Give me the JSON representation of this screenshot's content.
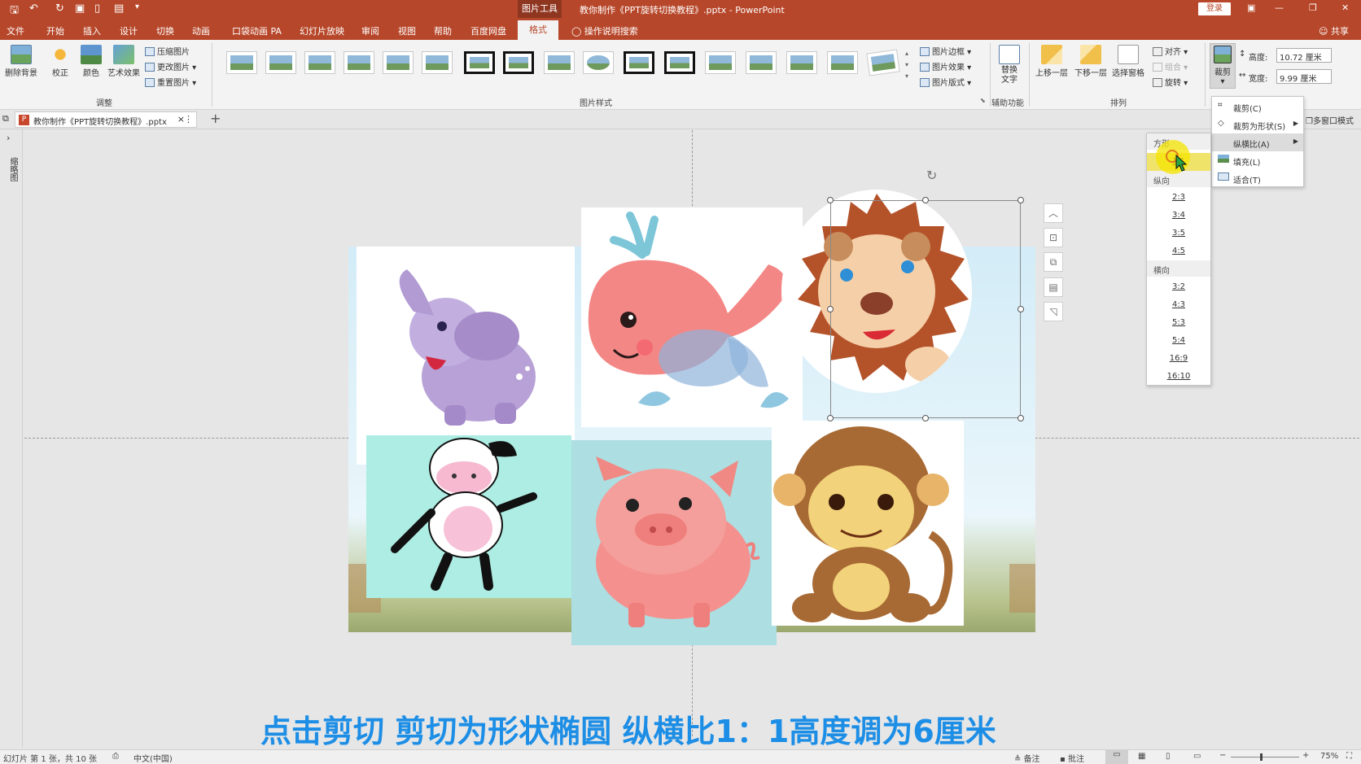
{
  "titlebar": {
    "context_tab": "图片工具",
    "title": "教你制作《PPT旋转切换教程》.pptx  -  PowerPoint",
    "login": "登录"
  },
  "tabs": [
    "文件",
    "开始",
    "插入",
    "设计",
    "切换",
    "动画",
    "口袋动画 PA",
    "幻灯片放映",
    "审阅",
    "视图",
    "帮助",
    "百度网盘"
  ],
  "active_tab": "格式",
  "tell_me": "操作说明搜索",
  "share": "共享",
  "ribbon": {
    "remove_bg": "删除背景",
    "correct": "校正",
    "color": "颜色",
    "art_effect": "艺术效果",
    "compress": "压缩图片",
    "change": "更改图片",
    "reset": "重置图片",
    "adjust_group": "调整",
    "styles_group": "图片样式",
    "border": "图片边框",
    "effect": "图片效果",
    "layout": "图片版式",
    "alt_text": "替换文字",
    "accessibility_group": "辅助功能",
    "bring_forward": "上移一层",
    "send_backward": "下移一层",
    "selection_pane": "选择窗格",
    "align": "对齐",
    "group": "组合",
    "rotate": "旋转",
    "arrange_group": "排列",
    "crop": "裁剪",
    "height_label": "高度:",
    "height_value": "10.72 厘米",
    "width_label": "宽度:",
    "width_value": "9.99 厘米"
  },
  "doc_tab": "教你制作《PPT旋转切换教程》.pptx",
  "multi_window": "多窗口模式",
  "thumb_pane_label": "缩略图",
  "crop_menu": {
    "crop": "裁剪(C)",
    "crop_to_shape": "裁剪为形状(S)",
    "aspect_ratio": "纵横比(A)",
    "fill": "填充(L)",
    "fit": "适合(T)"
  },
  "ratio_menu": {
    "square_header": "方形",
    "square": "1:1",
    "portrait_header": "纵向",
    "portrait": [
      "2:3",
      "3:4",
      "3:5",
      "4:5"
    ],
    "landscape_header": "横向",
    "landscape": [
      "3:2",
      "4:3",
      "5:3",
      "5:4",
      "16:9",
      "16:10"
    ]
  },
  "slide": {
    "animals": [
      "elephant",
      "whale",
      "lion",
      "cow",
      "pig",
      "monkey"
    ]
  },
  "caption": "点击剪切 剪切为形状椭圆 纵横比1：1高度调为6厘米",
  "statusbar": {
    "slide_info": "幻灯片 第 1 张，共 10 张",
    "language": "中文(中国)",
    "notes": "备注",
    "comments": "批注",
    "zoom": "75%"
  },
  "colors": {
    "accent": "#b7472a",
    "caption": "#1d8ee6",
    "highlight": "#f5e400"
  }
}
